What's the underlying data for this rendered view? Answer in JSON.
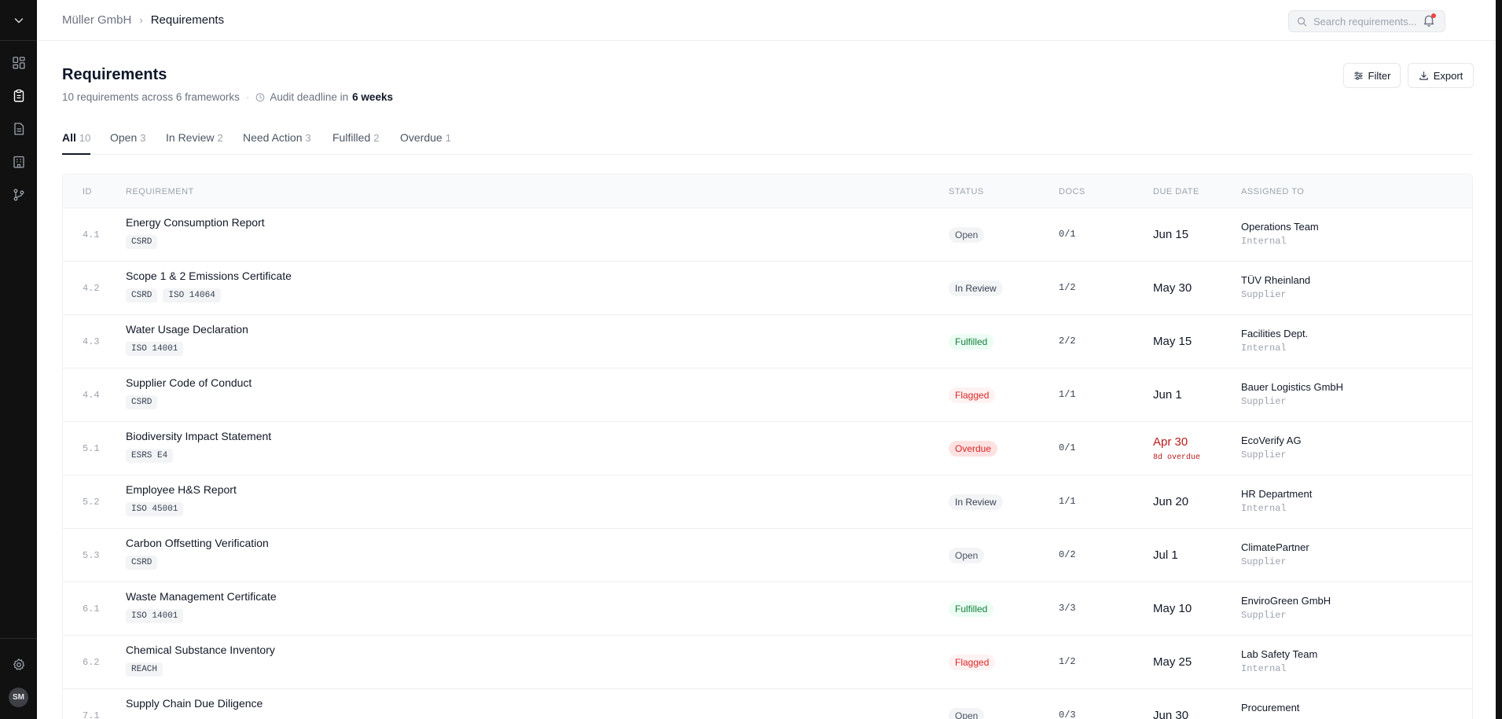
{
  "header": {
    "breadcrumb_root": "Müller GmbH",
    "breadcrumb_current": "Requirements",
    "search_placeholder": "Search requirements..."
  },
  "sidebar": {
    "avatar_initials": "SM",
    "icons": [
      "chevron-down-icon",
      "dashboard-icon",
      "clipboard-icon",
      "document-icon",
      "building-icon",
      "git-branch-icon",
      "gear-icon"
    ]
  },
  "page": {
    "title": "Requirements",
    "summary": "10 requirements across 6 frameworks",
    "deadline_label": "Audit deadline in",
    "deadline_value": "6 weeks",
    "filter_label": "Filter",
    "export_label": "Export"
  },
  "tabs": [
    {
      "label": "All",
      "count": "10"
    },
    {
      "label": "Open",
      "count": "3"
    },
    {
      "label": "In Review",
      "count": "2"
    },
    {
      "label": "Need Action",
      "count": "3"
    },
    {
      "label": "Fulfilled",
      "count": "2"
    },
    {
      "label": "Overdue",
      "count": "1"
    }
  ],
  "table": {
    "columns": [
      "ID",
      "REQUIREMENT",
      "STATUS",
      "DOCS",
      "DUE DATE",
      "ASSIGNED TO"
    ],
    "rows": [
      {
        "id": "4.1",
        "name": "Energy Consumption Report",
        "tags": [
          "CSRD"
        ],
        "status": "Open",
        "docs": "0/1",
        "due": "Jun 15",
        "due_note": "",
        "assignee": "Operations Team",
        "assignee_type": "Internal"
      },
      {
        "id": "4.2",
        "name": "Scope 1 & 2 Emissions Certificate",
        "tags": [
          "CSRD",
          "ISO 14064"
        ],
        "status": "In Review",
        "docs": "1/2",
        "due": "May 30",
        "due_note": "",
        "assignee": "TÜV Rheinland",
        "assignee_type": "Supplier"
      },
      {
        "id": "4.3",
        "name": "Water Usage Declaration",
        "tags": [
          "ISO 14001"
        ],
        "status": "Fulfilled",
        "docs": "2/2",
        "due": "May 15",
        "due_note": "",
        "assignee": "Facilities Dept.",
        "assignee_type": "Internal"
      },
      {
        "id": "4.4",
        "name": "Supplier Code of Conduct",
        "tags": [
          "CSRD"
        ],
        "status": "Flagged",
        "docs": "1/1",
        "due": "Jun 1",
        "due_note": "",
        "assignee": "Bauer Logistics GmbH",
        "assignee_type": "Supplier"
      },
      {
        "id": "5.1",
        "name": "Biodiversity Impact Statement",
        "tags": [
          "ESRS E4"
        ],
        "status": "Overdue",
        "docs": "0/1",
        "due": "Apr 30",
        "due_note": "8d overdue",
        "assignee": "EcoVerify AG",
        "assignee_type": "Supplier"
      },
      {
        "id": "5.2",
        "name": "Employee H&S Report",
        "tags": [
          "ISO 45001"
        ],
        "status": "In Review",
        "docs": "1/1",
        "due": "Jun 20",
        "due_note": "",
        "assignee": "HR Department",
        "assignee_type": "Internal"
      },
      {
        "id": "5.3",
        "name": "Carbon Offsetting Verification",
        "tags": [
          "CSRD"
        ],
        "status": "Open",
        "docs": "0/2",
        "due": "Jul 1",
        "due_note": "",
        "assignee": "ClimatePartner",
        "assignee_type": "Supplier"
      },
      {
        "id": "6.1",
        "name": "Waste Management Certificate",
        "tags": [
          "ISO 14001"
        ],
        "status": "Fulfilled",
        "docs": "3/3",
        "due": "May 10",
        "due_note": "",
        "assignee": "EnviroGreen GmbH",
        "assignee_type": "Supplier"
      },
      {
        "id": "6.2",
        "name": "Chemical Substance Inventory",
        "tags": [
          "REACH"
        ],
        "status": "Flagged",
        "docs": "1/2",
        "due": "May 25",
        "due_note": "",
        "assignee": "Lab Safety Team",
        "assignee_type": "Internal"
      },
      {
        "id": "7.1",
        "name": "Supply Chain Due Diligence",
        "tags": [],
        "status": "Open",
        "docs": "0/3",
        "due": "Jun 30",
        "due_note": "",
        "assignee": "Procurement",
        "assignee_type": ""
      }
    ]
  },
  "colors": {
    "sidebar_bg": "#111111",
    "fulfilled": "#15803d",
    "flagged": "#dc2626",
    "overdue_bg": "#fee2e2",
    "notification_dot": "#ef4444"
  }
}
